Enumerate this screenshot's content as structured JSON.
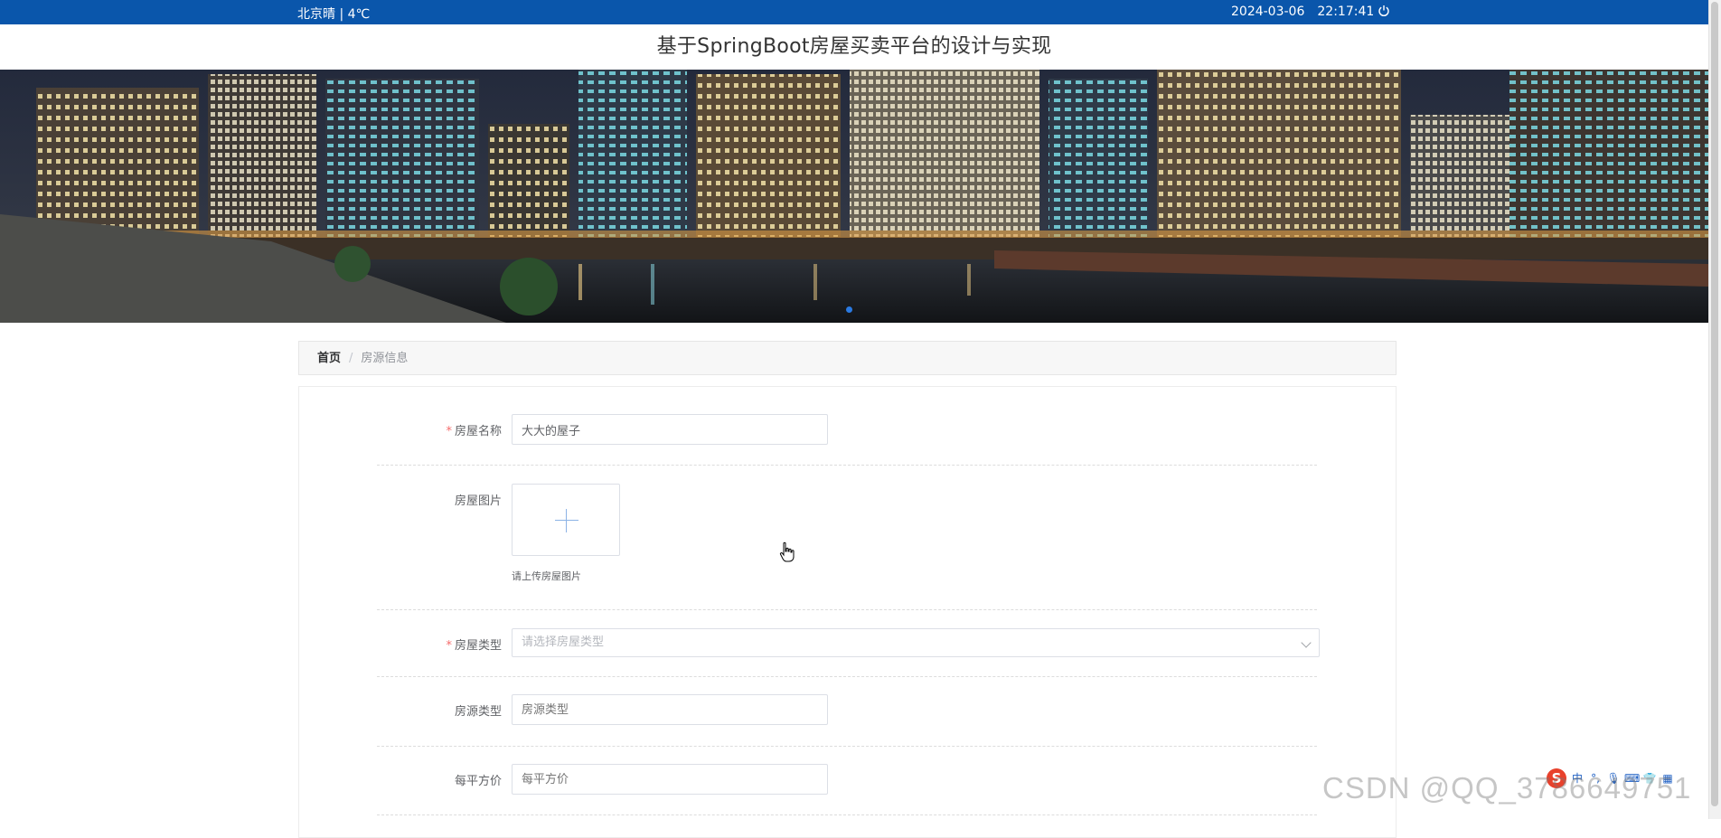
{
  "topbar": {
    "weather": "北京晴 | 4℃",
    "date": "2024-03-06",
    "time": "22:17:41",
    "power_icon": "power-icon"
  },
  "site": {
    "title": "基于SpringBoot房屋买卖平台的设计与实现"
  },
  "banner": {
    "image_description": "night city skyline by river"
  },
  "breadcrumb": {
    "home": "首页",
    "separator": "/",
    "current": "房源信息"
  },
  "form": {
    "house_name": {
      "label": "房屋名称",
      "value": "大大的屋子",
      "required": true
    },
    "house_image": {
      "label": "房屋图片",
      "tip": "请上传房屋图片",
      "required": false
    },
    "house_type": {
      "label": "房屋类型",
      "placeholder": "请选择房屋类型",
      "required": true
    },
    "source_type": {
      "label": "房源类型",
      "placeholder": "房源类型",
      "required": false
    },
    "price_per_sqm": {
      "label": "每平方价",
      "placeholder": "每平方价",
      "required": false
    }
  },
  "watermark": "CSDN @QQ_37866497​51",
  "ime": {
    "mode": "中",
    "icons": [
      "sogou-logo-icon",
      "punctuation-icon",
      "microphone-icon",
      "keyboard-icon",
      "shirt-icon",
      "grid-icon"
    ]
  },
  "colors": {
    "topbar": "#0a56ab",
    "required": "#f56c6c",
    "accent": "#2a7ae2"
  }
}
